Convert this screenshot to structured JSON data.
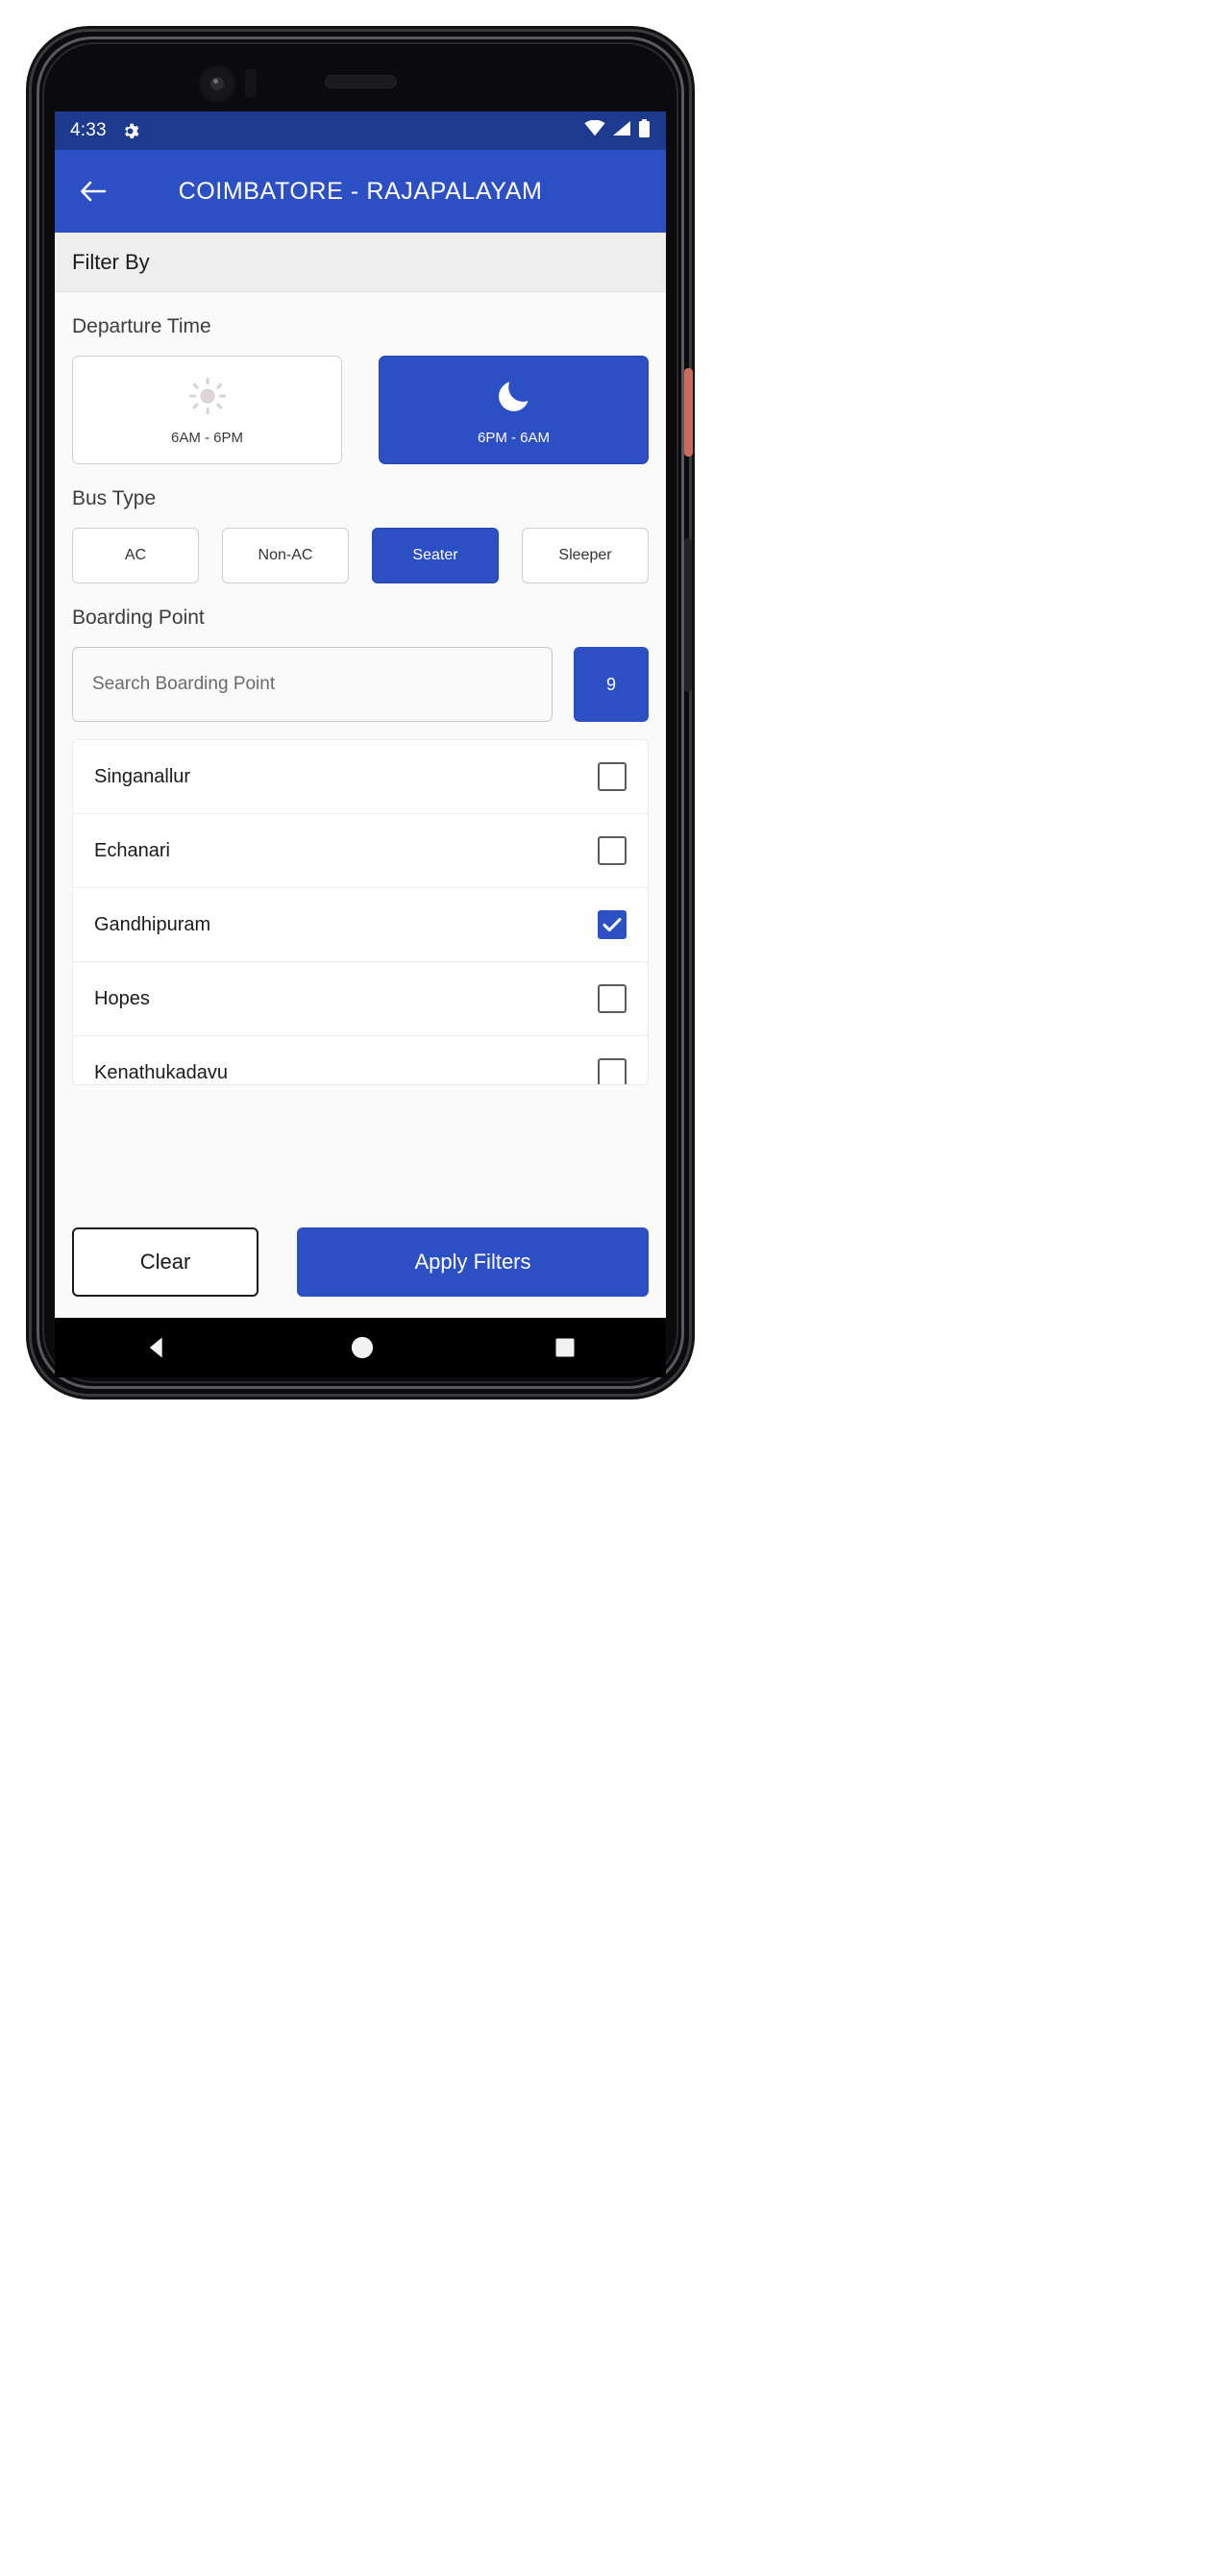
{
  "status_bar": {
    "time": "4:33",
    "gear_icon": "gear-icon",
    "wifi_icon": "wifi-icon",
    "signal_icon": "signal-icon",
    "battery_icon": "battery-icon"
  },
  "app_bar": {
    "back_icon": "back-arrow-icon",
    "title": "COIMBATORE - RAJAPALAYAM"
  },
  "filter_header": {
    "label": "Filter By"
  },
  "departure_time": {
    "label": "Departure Time",
    "options": [
      {
        "label": "6AM - 6PM",
        "icon": "sun-icon",
        "selected": false
      },
      {
        "label": "6PM - 6AM",
        "icon": "moon-icon",
        "selected": true
      }
    ]
  },
  "bus_type": {
    "label": "Bus Type",
    "options": [
      {
        "label": "AC",
        "selected": false
      },
      {
        "label": "Non-AC",
        "selected": false
      },
      {
        "label": "Seater",
        "selected": true
      },
      {
        "label": "Sleeper",
        "selected": false
      }
    ]
  },
  "boarding_point": {
    "label": "Boarding Point",
    "search_placeholder": "Search Boarding Point",
    "search_value": "",
    "count_badge": "9",
    "items": [
      {
        "name": "Singanallur",
        "checked": false
      },
      {
        "name": "Echanari",
        "checked": false
      },
      {
        "name": "Gandhipuram",
        "checked": true
      },
      {
        "name": "Hopes",
        "checked": false
      },
      {
        "name": "Kenathukadavu",
        "checked": false
      }
    ]
  },
  "actions": {
    "clear_label": "Clear",
    "apply_label": "Apply Filters"
  },
  "nav_bar": {
    "back_icon": "nav-back-triangle-icon",
    "home_icon": "nav-home-circle-icon",
    "recents_icon": "nav-recents-square-icon"
  },
  "colors": {
    "primary_blue": "#2d4fc4",
    "status_blue": "#1e3a8f",
    "header_gray": "#eeeeee",
    "body_gray": "#fafafa"
  }
}
